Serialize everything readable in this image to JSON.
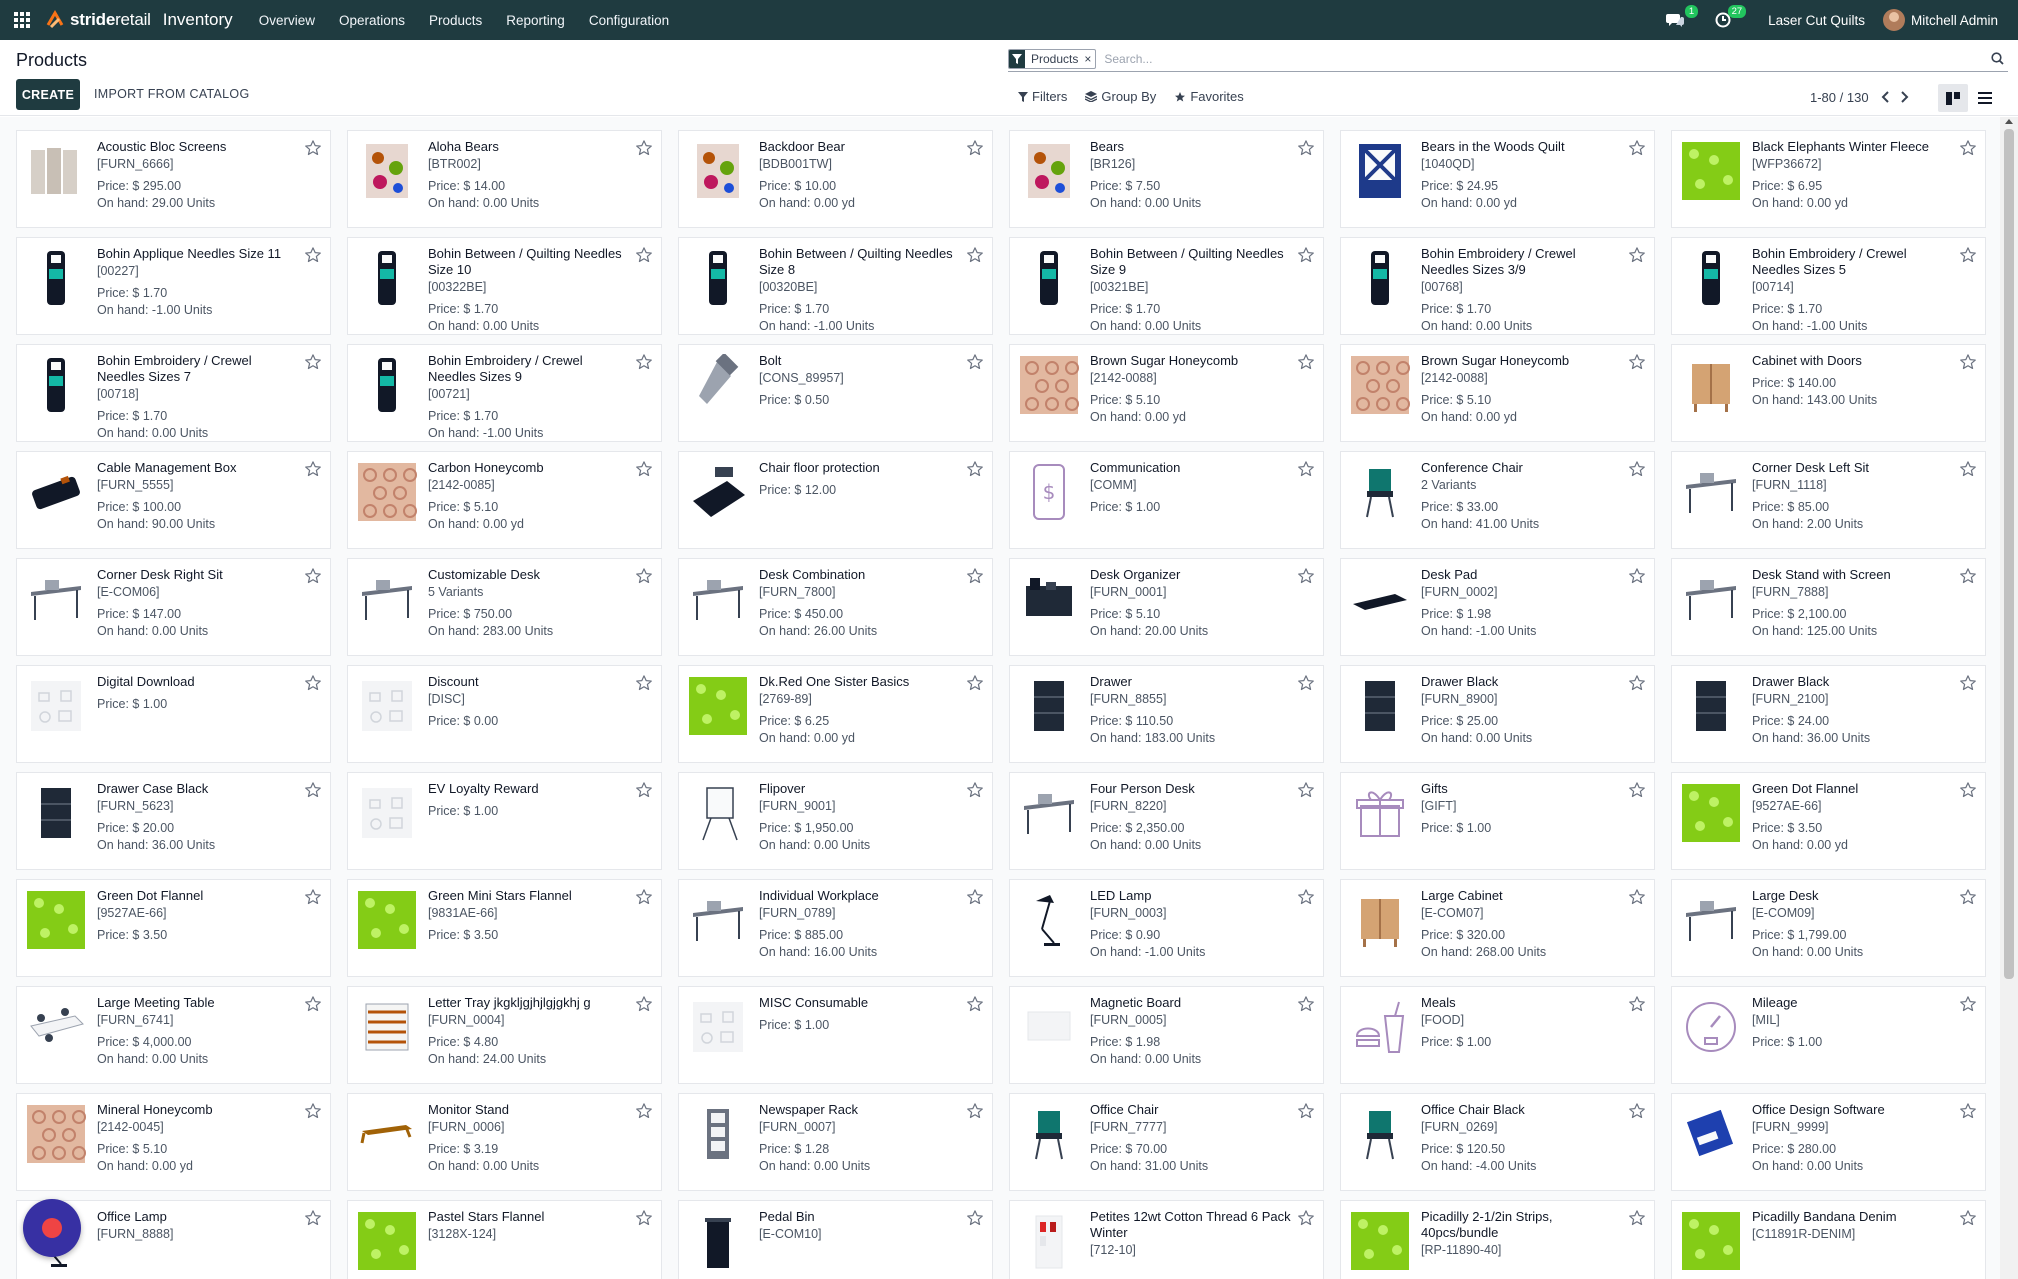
{
  "navbar": {
    "logo_part1": "stride",
    "logo_part2": "retail",
    "app_name": "Inventory",
    "menu": [
      "Overview",
      "Operations",
      "Products",
      "Reporting",
      "Configuration"
    ],
    "messages_count": "1",
    "activities_count": "27",
    "company": "Laser Cut Quilts",
    "user": "Mitchell Admin"
  },
  "control_panel": {
    "breadcrumb": "Products",
    "create_label": "CREATE",
    "import_label": "IMPORT FROM CATALOG",
    "facet_label": "Products",
    "facet_remove": "×",
    "search_placeholder": "Search...",
    "filters_label": "Filters",
    "groupby_label": "Group By",
    "favorites_label": "Favorites",
    "pager_value": "1-80 / 130"
  },
  "colors": {
    "navbar": "#1f3b40",
    "accent": "#1f3b40"
  },
  "products": [
    {
      "name": "Acoustic Bloc Screens",
      "code": "[FURN_6666]",
      "price": "Price: $ 295.00",
      "onhand": "On hand: 29.00 Units",
      "icon": "screen-icon"
    },
    {
      "name": "Aloha Bears",
      "code": "[BTR002]",
      "price": "Price: $ 14.00",
      "onhand": "On hand: 0.00 Units",
      "icon": "pattern-icon"
    },
    {
      "name": "Backdoor Bear",
      "code": "[BDB001TW]",
      "price": "Price: $ 10.00",
      "onhand": "On hand: 0.00 yd",
      "icon": "pattern-icon"
    },
    {
      "name": "Bears",
      "code": "[BR126]",
      "price": "Price: $ 7.50",
      "onhand": "On hand: 0.00 Units",
      "icon": "pattern-icon"
    },
    {
      "name": "Bears in the Woods Quilt",
      "code": "[1040QD]",
      "price": "Price: $ 24.95",
      "onhand": "On hand: 0.00 yd",
      "icon": "quilt-icon"
    },
    {
      "name": "Black Elephants Winter Fleece",
      "code": "[WFP36672]",
      "price": "Price: $ 6.95",
      "onhand": "On hand: 0.00 yd",
      "icon": "fabric-icon"
    },
    {
      "name": "Bohin Applique Needles Size 11",
      "code": "[00227]",
      "price": "Price: $ 1.70",
      "onhand": "On hand: -1.00 Units",
      "icon": "needles-icon"
    },
    {
      "name": "Bohin Between / Quilting Needles Size 10",
      "code": "[00322BE]",
      "price": "Price: $ 1.70",
      "onhand": "On hand: 0.00 Units",
      "icon": "needles-icon"
    },
    {
      "name": "Bohin Between / Quilting Needles Size 8",
      "code": "[00320BE]",
      "price": "Price: $ 1.70",
      "onhand": "On hand: -1.00 Units",
      "icon": "needles-icon"
    },
    {
      "name": "Bohin Between / Quilting Needles Size 9",
      "code": "[00321BE]",
      "price": "Price: $ 1.70",
      "onhand": "On hand: 0.00 Units",
      "icon": "needles-icon"
    },
    {
      "name": "Bohin Embroidery / Crewel Needles Sizes 3/9",
      "code": "[00768]",
      "price": "Price: $ 1.70",
      "onhand": "On hand: 0.00 Units",
      "icon": "needles-icon"
    },
    {
      "name": "Bohin Embroidery / Crewel Needles Sizes 5",
      "code": "[00714]",
      "price": "Price: $ 1.70",
      "onhand": "On hand: -1.00 Units",
      "icon": "needles-icon"
    },
    {
      "name": "Bohin Embroidery / Crewel Needles Sizes 7",
      "code": "[00718]",
      "price": "Price: $ 1.70",
      "onhand": "On hand: 0.00 Units",
      "icon": "needles-icon"
    },
    {
      "name": "Bohin Embroidery / Crewel Needles Sizes 9",
      "code": "[00721]",
      "price": "Price: $ 1.70",
      "onhand": "On hand: -1.00 Units",
      "icon": "needles-icon"
    },
    {
      "name": "Bolt",
      "code": "[CONS_89957]",
      "price": "Price: $ 0.50",
      "onhand": "",
      "icon": "bolt-icon"
    },
    {
      "name": "Brown Sugar Honeycomb",
      "code": "[2142-0088]",
      "price": "Price: $ 5.10",
      "onhand": "On hand: 0.00 yd",
      "icon": "honeycomb-icon"
    },
    {
      "name": "Brown Sugar Honeycomb",
      "code": "[2142-0088]",
      "price": "Price: $ 5.10",
      "onhand": "On hand: 0.00 yd",
      "icon": "honeycomb-icon"
    },
    {
      "name": "Cabinet with Doors",
      "code": "",
      "price": "Price: $ 140.00",
      "onhand": "On hand: 143.00 Units",
      "icon": "cabinet-icon"
    },
    {
      "name": "Cable Management Box",
      "code": "[FURN_5555]",
      "price": "Price: $ 100.00",
      "onhand": "On hand: 90.00 Units",
      "icon": "box-icon"
    },
    {
      "name": "Carbon Honeycomb",
      "code": "[2142-0085]",
      "price": "Price: $ 5.10",
      "onhand": "On hand: 0.00 yd",
      "icon": "honeycomb-icon"
    },
    {
      "name": "Chair floor protection",
      "code": "",
      "price": "Price: $ 12.00",
      "onhand": "",
      "icon": "mat-icon"
    },
    {
      "name": "Communication",
      "code": "[COMM]",
      "price": "Price: $ 1.00",
      "onhand": "",
      "icon": "phone-icon"
    },
    {
      "name": "Conference Chair",
      "code": "2 Variants",
      "price": "Price: $ 33.00",
      "onhand": "On hand: 41.00 Units",
      "icon": "chair-icon"
    },
    {
      "name": "Corner Desk Left Sit",
      "code": "[FURN_1118]",
      "price": "Price: $ 85.00",
      "onhand": "On hand: 2.00 Units",
      "icon": "desk-icon"
    },
    {
      "name": "Corner Desk Right Sit",
      "code": "[E-COM06]",
      "price": "Price: $ 147.00",
      "onhand": "On hand: 0.00 Units",
      "icon": "desk-icon"
    },
    {
      "name": "Customizable Desk",
      "code": "5 Variants",
      "price": "Price: $ 750.00",
      "onhand": "On hand: 283.00 Units",
      "icon": "desk-icon"
    },
    {
      "name": "Desk Combination",
      "code": "[FURN_7800]",
      "price": "Price: $ 450.00",
      "onhand": "On hand: 26.00 Units",
      "icon": "desk-icon"
    },
    {
      "name": "Desk Organizer",
      "code": "[FURN_0001]",
      "price": "Price: $ 5.10",
      "onhand": "On hand: 20.00 Units",
      "icon": "organizer-icon"
    },
    {
      "name": "Desk Pad",
      "code": "[FURN_0002]",
      "price": "Price: $ 1.98",
      "onhand": "On hand: -1.00 Units",
      "icon": "pad-icon"
    },
    {
      "name": "Desk Stand with Screen",
      "code": "[FURN_7888]",
      "price": "Price: $ 2,100.00",
      "onhand": "On hand: 125.00 Units",
      "icon": "desk-icon"
    },
    {
      "name": "Digital Download",
      "code": "",
      "price": "Price: $ 1.00",
      "onhand": "",
      "icon": "placeholder-icon"
    },
    {
      "name": "Discount",
      "code": "[DISC]",
      "price": "Price: $ 0.00",
      "onhand": "",
      "icon": "placeholder-icon"
    },
    {
      "name": "Dk.Red One Sister Basics",
      "code": "[2769-89]",
      "price": "Price: $ 6.25",
      "onhand": "On hand: 0.00 yd",
      "icon": "fabric-icon"
    },
    {
      "name": "Drawer",
      "code": "[FURN_8855]",
      "price": "Price: $ 110.50",
      "onhand": "On hand: 183.00 Units",
      "icon": "drawer-icon"
    },
    {
      "name": "Drawer Black",
      "code": "[FURN_8900]",
      "price": "Price: $ 25.00",
      "onhand": "On hand: 0.00 Units",
      "icon": "drawer-icon"
    },
    {
      "name": "Drawer Black",
      "code": "[FURN_2100]",
      "price": "Price: $ 24.00",
      "onhand": "On hand: 36.00 Units",
      "icon": "drawer-icon"
    },
    {
      "name": "Drawer Case Black",
      "code": "[FURN_5623]",
      "price": "Price: $ 20.00",
      "onhand": "On hand: 36.00 Units",
      "icon": "drawer-icon"
    },
    {
      "name": "EV Loyalty Reward",
      "code": "",
      "price": "Price: $ 1.00",
      "onhand": "",
      "icon": "placeholder-icon"
    },
    {
      "name": "Flipover",
      "code": "[FURN_9001]",
      "price": "Price: $ 1,950.00",
      "onhand": "On hand: 0.00 Units",
      "icon": "flipchart-icon"
    },
    {
      "name": "Four Person Desk",
      "code": "[FURN_8220]",
      "price": "Price: $ 2,350.00",
      "onhand": "On hand: 0.00 Units",
      "icon": "desk-icon"
    },
    {
      "name": "Gifts",
      "code": "[GIFT]",
      "price": "Price: $ 1.00",
      "onhand": "",
      "icon": "gift-icon"
    },
    {
      "name": "Green Dot Flannel",
      "code": "[9527AE-66]",
      "price": "Price: $ 3.50",
      "onhand": "On hand: 0.00 yd",
      "icon": "fabric-icon"
    },
    {
      "name": "Green Dot Flannel",
      "code": "[9527AE-66]",
      "price": "Price: $ 3.50",
      "onhand": "",
      "icon": "fabric-icon"
    },
    {
      "name": "Green Mini Stars Flannel",
      "code": "[9831AE-66]",
      "price": "Price: $ 3.50",
      "onhand": "",
      "icon": "fabric-icon"
    },
    {
      "name": "Individual Workplace",
      "code": "[FURN_0789]",
      "price": "Price: $ 885.00",
      "onhand": "On hand: 16.00 Units",
      "icon": "desk-icon"
    },
    {
      "name": "LED Lamp",
      "code": "[FURN_0003]",
      "price": "Price: $ 0.90",
      "onhand": "On hand: -1.00 Units",
      "icon": "lamp-icon"
    },
    {
      "name": "Large Cabinet",
      "code": "[E-COM07]",
      "price": "Price: $ 320.00",
      "onhand": "On hand: 268.00 Units",
      "icon": "cabinet-icon"
    },
    {
      "name": "Large Desk",
      "code": "[E-COM09]",
      "price": "Price: $ 1,799.00",
      "onhand": "On hand: 0.00 Units",
      "icon": "desk-icon"
    },
    {
      "name": "Large Meeting Table",
      "code": "[FURN_6741]",
      "price": "Price: $ 4,000.00",
      "onhand": "On hand: 0.00 Units",
      "icon": "table-icon"
    },
    {
      "name": "Letter Tray jkgkljgjhjlgjgkhj g",
      "code": "[FURN_0004]",
      "price": "Price: $ 4.80",
      "onhand": "On hand: 24.00 Units",
      "icon": "tray-icon"
    },
    {
      "name": "MISC Consumable",
      "code": "",
      "price": "Price: $ 1.00",
      "onhand": "",
      "icon": "placeholder-icon"
    },
    {
      "name": "Magnetic Board",
      "code": "[FURN_0005]",
      "price": "Price: $ 1.98",
      "onhand": "On hand: 0.00 Units",
      "icon": "board-icon"
    },
    {
      "name": "Meals",
      "code": "[FOOD]",
      "price": "Price: $ 1.00",
      "onhand": "",
      "icon": "meal-icon"
    },
    {
      "name": "Mileage",
      "code": "[MIL]",
      "price": "Price: $ 1.00",
      "onhand": "",
      "icon": "gauge-icon"
    },
    {
      "name": "Mineral Honeycomb",
      "code": "[2142-0045]",
      "price": "Price: $ 5.10",
      "onhand": "On hand: 0.00 yd",
      "icon": "honeycomb-icon"
    },
    {
      "name": "Monitor Stand",
      "code": "[FURN_0006]",
      "price": "Price: $ 3.19",
      "onhand": "On hand: 0.00 Units",
      "icon": "stand-icon"
    },
    {
      "name": "Newspaper Rack",
      "code": "[FURN_0007]",
      "price": "Price: $ 1.28",
      "onhand": "On hand: 0.00 Units",
      "icon": "rack-icon"
    },
    {
      "name": "Office Chair",
      "code": "[FURN_7777]",
      "price": "Price: $ 70.00",
      "onhand": "On hand: 31.00 Units",
      "icon": "chair-icon"
    },
    {
      "name": "Office Chair Black",
      "code": "[FURN_0269]",
      "price": "Price: $ 120.50",
      "onhand": "On hand: -4.00 Units",
      "icon": "chair-icon"
    },
    {
      "name": "Office Design Software",
      "code": "[FURN_9999]",
      "price": "Price: $ 280.00",
      "onhand": "On hand: 0.00 Units",
      "icon": "software-icon"
    },
    {
      "name": "Office Lamp",
      "code": "[FURN_8888]",
      "price": "",
      "onhand": "",
      "icon": "lamp-icon"
    },
    {
      "name": "Pastel Stars Flannel",
      "code": "[3128X-124]",
      "price": "",
      "onhand": "",
      "icon": "fabric-icon"
    },
    {
      "name": "Pedal Bin",
      "code": "[E-COM10]",
      "price": "",
      "onhand": "",
      "icon": "bin-icon"
    },
    {
      "name": "Petites 12wt Cotton Thread 6 Pack Winter",
      "code": "[712-10]",
      "price": "",
      "onhand": "",
      "icon": "thread-icon"
    },
    {
      "name": "Picadilly 2-1/2in Strips, 40pcs/bundle",
      "code": "[RP-11890-40]",
      "price": "",
      "onhand": "",
      "icon": "fabric-icon"
    },
    {
      "name": "Picadilly Bandana Denim",
      "code": "[C11891R-DENIM]",
      "price": "",
      "onhand": "",
      "icon": "fabric-icon"
    }
  ]
}
